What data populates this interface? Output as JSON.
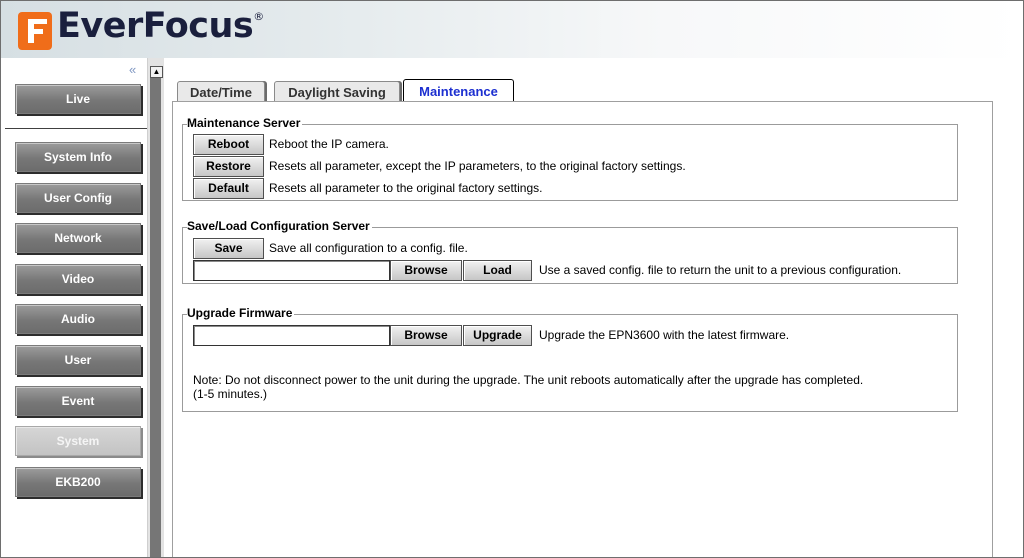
{
  "brand": {
    "logo_letter": "F",
    "name": "EverFocus",
    "registered": "®"
  },
  "sidebar": {
    "collapse_icon": "«",
    "items": [
      {
        "label": "Live"
      },
      {
        "label": "System Info"
      },
      {
        "label": "User Config"
      },
      {
        "label": "Network"
      },
      {
        "label": "Video"
      },
      {
        "label": "Audio"
      },
      {
        "label": "User"
      },
      {
        "label": "Event"
      },
      {
        "label": "System",
        "active": true
      },
      {
        "label": "EKB200"
      }
    ]
  },
  "tabs": [
    {
      "label": "Date/Time"
    },
    {
      "label": "Daylight Saving"
    },
    {
      "label": "Maintenance",
      "active": true
    }
  ],
  "maintenance_server": {
    "legend": "Maintenance Server",
    "rows": [
      {
        "button": "Reboot",
        "description": "Reboot the IP camera."
      },
      {
        "button": "Restore",
        "description": "Resets all parameter, except the IP parameters, to the original factory settings."
      },
      {
        "button": "Default",
        "description": "Resets all parameter to the original factory settings."
      }
    ]
  },
  "save_load": {
    "legend": "Save/Load Configuration Server",
    "save_button": "Save",
    "save_description": "Save all configuration to a config. file.",
    "file_value": "",
    "browse_button": "Browse",
    "load_button": "Load",
    "load_description": "Use a saved config. file to return the unit to a previous configuration."
  },
  "upgrade": {
    "legend": "Upgrade Firmware",
    "file_value": "",
    "browse_button": "Browse",
    "upgrade_button": "Upgrade",
    "description": "Upgrade the EPN3600 with the latest firmware.",
    "note_line1": "Note: Do not disconnect power to the unit during the upgrade. The unit reboots automatically after the upgrade has completed.",
    "note_line2": "(1-5 minutes.)"
  },
  "colors": {
    "active_tab": "#1c2fd0",
    "logo_orange": "#f06d1a",
    "nav_button": "#7a7a7a"
  }
}
